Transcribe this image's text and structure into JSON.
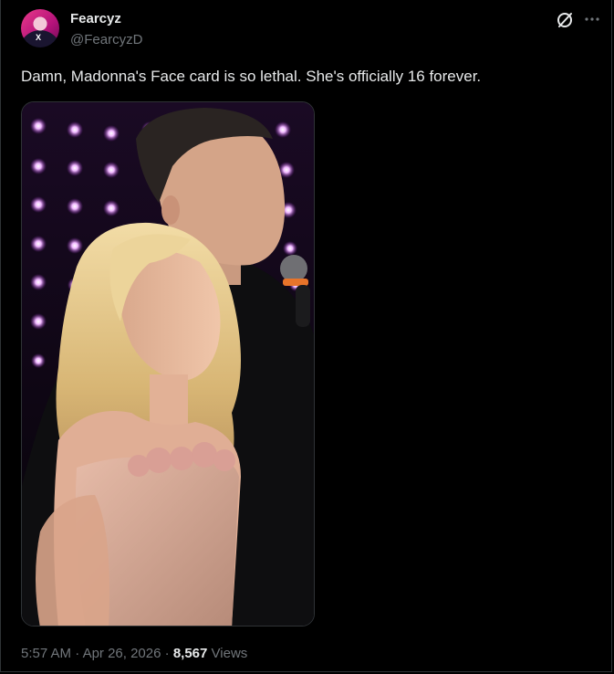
{
  "author": {
    "name": "Fearcyz",
    "handle": "@FearcyzD",
    "avatar_badge": "X"
  },
  "post": {
    "text": "Damn, Madonna's Face card is so lethal. She's officially 16 forever.",
    "media_description_icon": "photo",
    "time": "5:57 AM",
    "separator": "·",
    "date": "Apr 26, 2026",
    "views_count": "8,567",
    "views_label": "Views"
  },
  "icons": {
    "grok": "grok-icon",
    "more": "more-icon"
  },
  "colors": {
    "background": "#000000",
    "text_primary": "#e7e9ea",
    "text_secondary": "#71767b",
    "border": "#2f3336"
  }
}
